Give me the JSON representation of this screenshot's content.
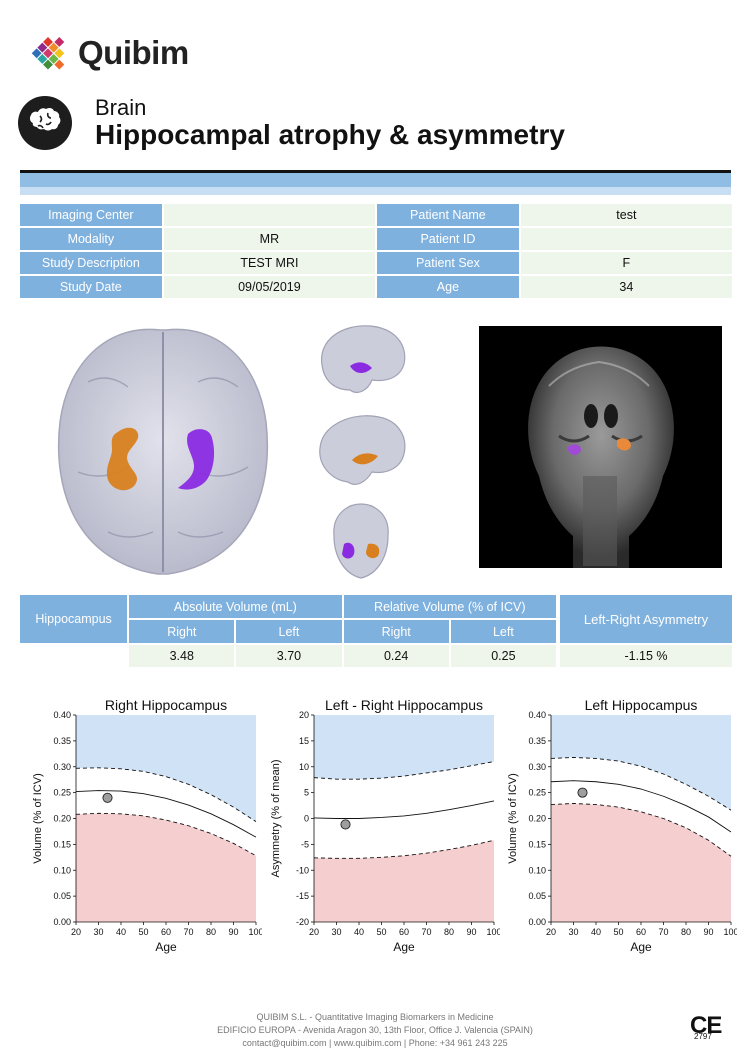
{
  "brand": {
    "name": "Quibim"
  },
  "header": {
    "subtitle": "Brain",
    "title": "Hippocampal atrophy & asymmetry"
  },
  "patient_info": {
    "rows": [
      {
        "label1": "Imaging Center",
        "value1": "",
        "label2": "Patient Name",
        "value2": "test"
      },
      {
        "label1": "Modality",
        "value1": "MR",
        "label2": "Patient ID",
        "value2": ""
      },
      {
        "label1": "Study Description",
        "value1": "TEST MRI",
        "label2": "Patient Sex",
        "value2": "F"
      },
      {
        "label1": "Study Date",
        "value1": "09/05/2019",
        "label2": "Age",
        "value2": "34"
      }
    ]
  },
  "volumes": {
    "row_label": "Hippocampus",
    "absolute_label": "Absolute Volume (mL)",
    "relative_label": "Relative Volume (% of ICV)",
    "asymmetry_label": "Left-Right Asymmetry",
    "right_label": "Right",
    "left_label": "Left",
    "abs_right": "3.48",
    "abs_left": "3.70",
    "rel_right": "0.24",
    "rel_left": "0.25",
    "asymmetry": "-1.15 %"
  },
  "colors": {
    "header_blue": "#7fb1de",
    "cell_green": "#eef5ea",
    "above_band": "#cfe2f6",
    "below_band": "#f5cfd0",
    "right_hippocampus": "#d8801f",
    "left_hippocampus": "#8a2be2"
  },
  "chart_data": [
    {
      "type": "line",
      "title": "Right Hippocampus",
      "xlabel": "Age",
      "ylabel": "Volume (% of ICV)",
      "xlim": [
        20,
        100
      ],
      "ylim": [
        0,
        0.4
      ],
      "xticks": [
        "20",
        "30",
        "40",
        "50",
        "60",
        "70",
        "80",
        "90",
        "100"
      ],
      "yticks": [
        "0.00",
        "0.05",
        "0.10",
        "0.15",
        "0.20",
        "0.25",
        "0.30",
        "0.35",
        "0.40"
      ],
      "series": [
        {
          "x": [
            20,
            30,
            40,
            50,
            60,
            70,
            80,
            90,
            100
          ],
          "values": [
            0.297,
            0.298,
            0.296,
            0.291,
            0.281,
            0.266,
            0.246,
            0.222,
            0.194
          ]
        },
        {
          "x": [
            20,
            30,
            40,
            50,
            60,
            70,
            80,
            90,
            100
          ],
          "values": [
            0.252,
            0.254,
            0.253,
            0.248,
            0.239,
            0.226,
            0.209,
            0.188,
            0.164
          ]
        },
        {
          "x": [
            20,
            30,
            40,
            50,
            60,
            70,
            80,
            90,
            100
          ],
          "values": [
            0.208,
            0.21,
            0.209,
            0.205,
            0.197,
            0.186,
            0.171,
            0.152,
            0.128
          ]
        }
      ],
      "point": {
        "x": 34,
        "y": 0.24
      }
    },
    {
      "type": "line",
      "title": "Left - Right Hippocampus",
      "xlabel": "Age",
      "ylabel": "Asymmetry (% of mean)",
      "xlim": [
        20,
        100
      ],
      "ylim": [
        -20,
        20
      ],
      "xticks": [
        "20",
        "30",
        "40",
        "50",
        "60",
        "70",
        "80",
        "90",
        "100"
      ],
      "yticks": [
        "-20",
        "-15",
        "-10",
        "-5",
        "0",
        "5",
        "10",
        "15",
        "20"
      ],
      "series": [
        {
          "x": [
            20,
            30,
            40,
            50,
            60,
            70,
            80,
            90,
            100
          ],
          "values": [
            7.9,
            7.6,
            7.6,
            7.8,
            8.2,
            8.8,
            9.4,
            10.2,
            11.0
          ]
        },
        {
          "x": [
            20,
            30,
            40,
            50,
            60,
            70,
            80,
            90,
            100
          ],
          "values": [
            0.1,
            0.0,
            0.0,
            0.2,
            0.5,
            1.0,
            1.7,
            2.5,
            3.4
          ]
        },
        {
          "x": [
            20,
            30,
            40,
            50,
            60,
            70,
            80,
            90,
            100
          ],
          "values": [
            -7.6,
            -7.7,
            -7.7,
            -7.5,
            -7.2,
            -6.7,
            -6.0,
            -5.2,
            -4.2
          ]
        }
      ],
      "point": {
        "x": 34,
        "y": -1.15
      }
    },
    {
      "type": "line",
      "title": "Left Hippocampus",
      "xlabel": "Age",
      "ylabel": "Volume (% of ICV)",
      "xlim": [
        20,
        100
      ],
      "ylim": [
        0,
        0.4
      ],
      "xticks": [
        "20",
        "30",
        "40",
        "50",
        "60",
        "70",
        "80",
        "90",
        "100"
      ],
      "yticks": [
        "0.00",
        "0.05",
        "0.10",
        "0.15",
        "0.20",
        "0.25",
        "0.30",
        "0.35",
        "0.40"
      ],
      "series": [
        {
          "x": [
            20,
            30,
            40,
            50,
            60,
            70,
            80,
            90,
            100
          ],
          "values": [
            0.316,
            0.318,
            0.316,
            0.311,
            0.301,
            0.286,
            0.266,
            0.243,
            0.216
          ]
        },
        {
          "x": [
            20,
            30,
            40,
            50,
            60,
            70,
            80,
            90,
            100
          ],
          "values": [
            0.271,
            0.273,
            0.271,
            0.266,
            0.257,
            0.243,
            0.225,
            0.203,
            0.174
          ]
        },
        {
          "x": [
            20,
            30,
            40,
            50,
            60,
            70,
            80,
            90,
            100
          ],
          "values": [
            0.227,
            0.229,
            0.227,
            0.222,
            0.213,
            0.2,
            0.182,
            0.158,
            0.127
          ]
        }
      ],
      "point": {
        "x": 34,
        "y": 0.25
      }
    }
  ],
  "footer": {
    "line1": "QUIBIM S.L. - Quantitative Imaging Biomarkers in Medicine",
    "line2": "EDIFICIO EUROPA - Avenida Aragon 30, 13th Floor, Office J. Valencia (SPAIN)",
    "line3": "contact@quibim.com  |  www.quibim.com  |    Phone: +34 961 243 225",
    "ce_mark": "CE",
    "ce_number": "2797"
  }
}
